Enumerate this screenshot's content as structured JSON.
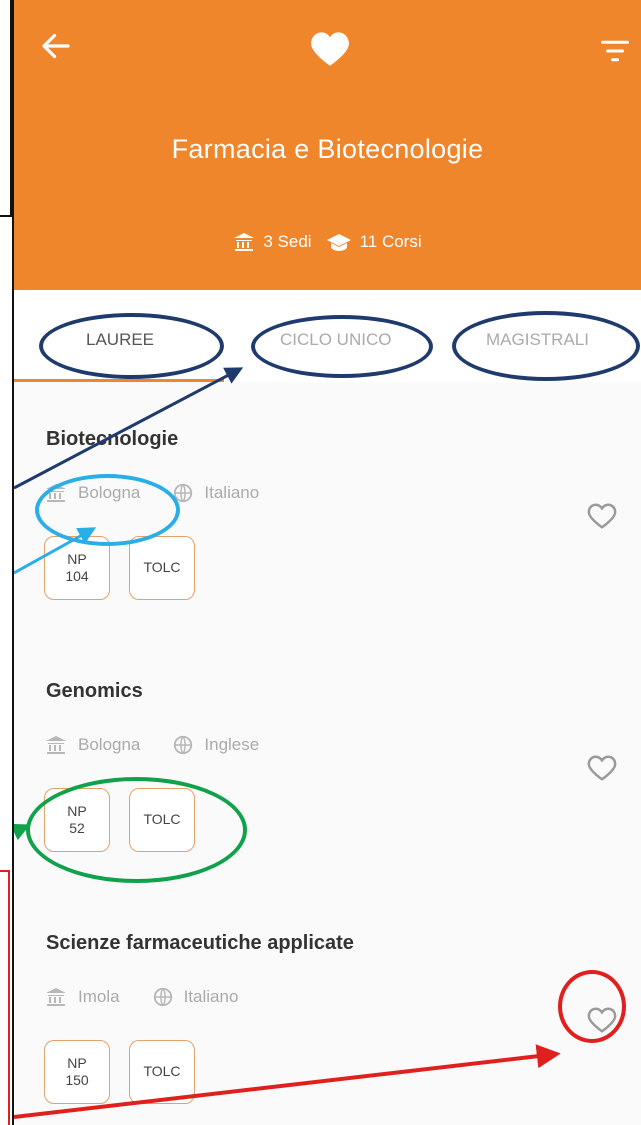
{
  "header": {
    "title": "Farmacia e Biotecnologie",
    "sedi": "3 Sedi",
    "corsi": "11 Corsi"
  },
  "tabs": [
    {
      "label": "LAUREE"
    },
    {
      "label": "CICLO UNICO"
    },
    {
      "label": "MAGISTRALI"
    }
  ],
  "courses": [
    {
      "name": "Biotecnologie",
      "city": "Bologna",
      "language": "Italiano",
      "np_label": "NP",
      "np_value": "104",
      "tolc": "TOLC"
    },
    {
      "name": "Genomics",
      "city": "Bologna",
      "language": "Inglese",
      "np_label": "NP",
      "np_value": "52",
      "tolc": "TOLC"
    },
    {
      "name": "Scienze farmaceutiche applicate",
      "city": "Imola",
      "language": "Italiano",
      "np_label": "NP",
      "np_value": "150",
      "tolc": "TOLC"
    }
  ],
  "colors": {
    "accent": "#f0862b",
    "annotation_blue": "#1f3b6d",
    "annotation_lightblue": "#2aaee6",
    "annotation_green": "#11a14b",
    "annotation_red": "#e0201e"
  }
}
